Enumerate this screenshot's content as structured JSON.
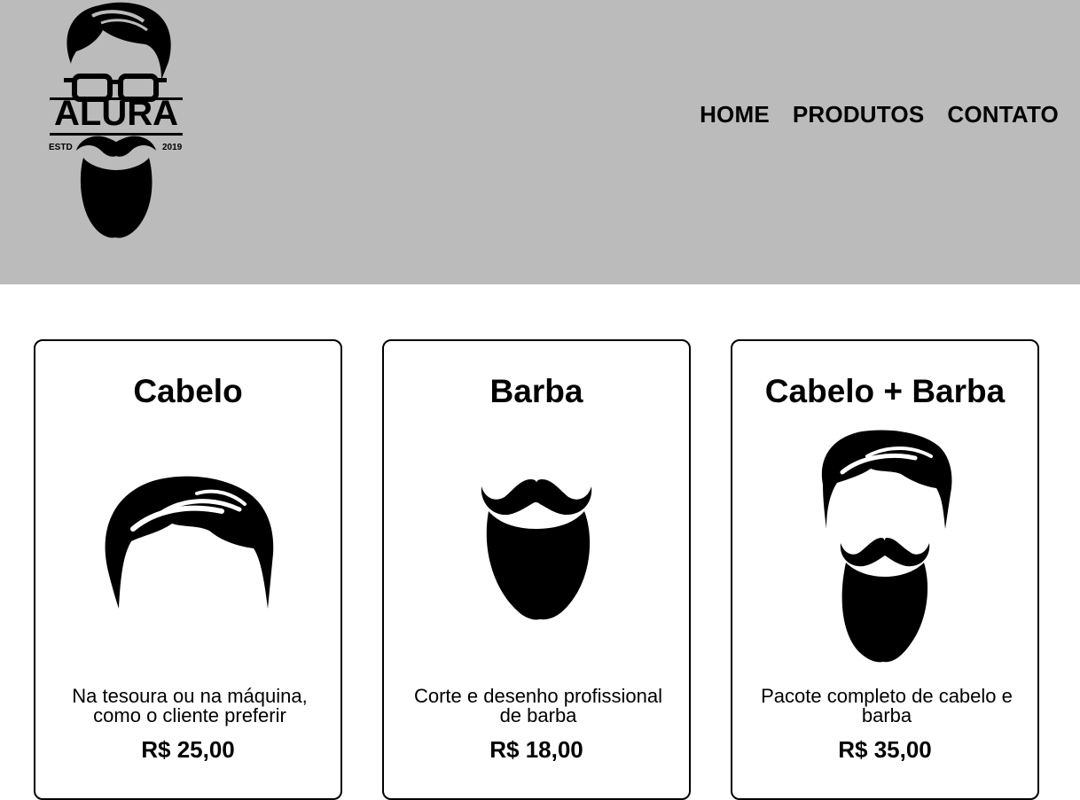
{
  "header": {
    "logo": {
      "text": "ALURA",
      "estd": "ESTD",
      "year": "2019"
    },
    "nav": [
      {
        "label": "HOME"
      },
      {
        "label": "PRODUTOS"
      },
      {
        "label": "CONTATO"
      }
    ]
  },
  "products": [
    {
      "title": "Cabelo",
      "icon": "hair-icon",
      "description": "Na tesoura ou na máquina, como o cliente preferir",
      "price": "R$ 25,00"
    },
    {
      "title": "Barba",
      "icon": "beard-icon",
      "description": "Corte e desenho profissional de barba",
      "price": "R$ 18,00"
    },
    {
      "title": "Cabelo + Barba",
      "icon": "hair-and-beard-icon",
      "description": "Pacote completo de cabelo e barba",
      "price": "R$ 35,00"
    }
  ],
  "colors": {
    "header_background": "#bbbbbb",
    "page_background": "#ffffff",
    "text": "#000000"
  }
}
